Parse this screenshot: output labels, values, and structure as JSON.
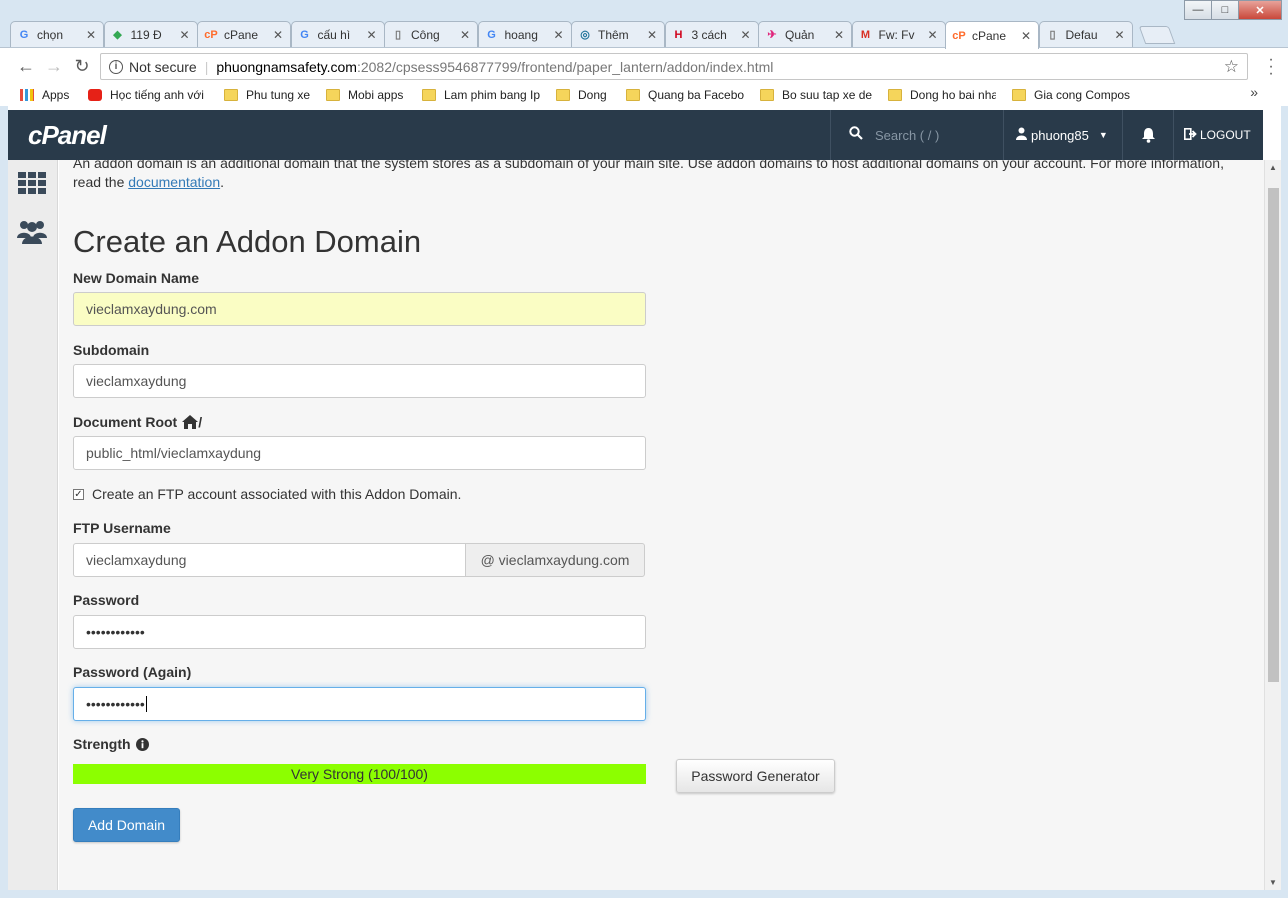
{
  "browser": {
    "tabs": [
      {
        "title": "chọn",
        "icon": "google-icon",
        "color": "#4285f4"
      },
      {
        "title": "119 Đ",
        "icon": "maps-icon",
        "color": "#34a853"
      },
      {
        "title": "cPane",
        "icon": "cpanel-icon",
        "color": "#ff6c2c"
      },
      {
        "title": "cấu hì",
        "icon": "google-icon",
        "color": "#4285f4"
      },
      {
        "title": "Công",
        "icon": "page-icon",
        "color": "#777777"
      },
      {
        "title": "hoang",
        "icon": "google-icon",
        "color": "#4285f4"
      },
      {
        "title": "Thêm",
        "icon": "wordpress-icon",
        "color": "#21759b"
      },
      {
        "title": "3 cách",
        "icon": "hvn-icon",
        "color": "#d0021b"
      },
      {
        "title": "Quản",
        "icon": "helicopter-icon",
        "color": "#e0247a"
      },
      {
        "title": "Fw: Fv",
        "icon": "gmail-icon",
        "color": "#d93025"
      },
      {
        "title": "cPane",
        "icon": "cpanel-icon",
        "color": "#ff6c2c",
        "active": true
      },
      {
        "title": "Defau",
        "icon": "page-icon",
        "color": "#777777"
      }
    ],
    "security_label": "Not secure",
    "url_host": "phuongnamsafety.com",
    "url_path": ":2082/cpsess9546877799/frontend/paper_lantern/addon/index.html",
    "bookmarks": [
      {
        "label": "Apps",
        "type": "apps"
      },
      {
        "label": "Học tiếng anh với Eng",
        "type": "youtube"
      },
      {
        "label": "Phu tung xe",
        "type": "folder"
      },
      {
        "label": "Mobi apps",
        "type": "folder"
      },
      {
        "label": "Lam phim bang Iphon",
        "type": "folder"
      },
      {
        "label": "Dong y",
        "type": "folder"
      },
      {
        "label": "Quang ba Facebook",
        "type": "folder"
      },
      {
        "label": "Bo suu tap xe dep",
        "type": "folder"
      },
      {
        "label": "Dong ho bai nhat",
        "type": "folder"
      },
      {
        "label": "Gia cong Composite",
        "type": "folder"
      }
    ],
    "bookmarks_more": "»"
  },
  "cpanel": {
    "logo": "cPanel",
    "search_placeholder": "Search ( / )",
    "username": "phuong85",
    "logout": "LOGOUT"
  },
  "page": {
    "intro_text": "An addon domain is an additional domain that the system stores as a subdomain of your main site. Use addon domains to host additional domains on your account. For more information, read the ",
    "intro_link": "documentation",
    "intro_end": ".",
    "title": "Create an Addon Domain"
  },
  "form": {
    "new_domain_label": "New Domain Name",
    "new_domain_value": "vieclamxaydung.com",
    "subdomain_label": "Subdomain",
    "subdomain_value": "vieclamxaydung",
    "docroot_label": "Document Root",
    "docroot_suffix": "/",
    "docroot_value": "public_html/vieclamxaydung",
    "ftp_checkbox_label": "Create an FTP account associated with this Addon Domain.",
    "ftp_checked": true,
    "ftp_username_label": "FTP Username",
    "ftp_username_value": "vieclamxaydung",
    "ftp_domain_addon": "@ vieclamxaydung.com",
    "password_label": "Password",
    "password_value": "••••••••••••",
    "password_again_label": "Password (Again)",
    "password_again_value": "••••••••••••",
    "strength_label": "Strength",
    "strength_text": "Very Strong (100/100)",
    "strength_score": 100,
    "strength_color": "#8cff00",
    "password_generator": "Password Generator",
    "submit": "Add Domain"
  }
}
